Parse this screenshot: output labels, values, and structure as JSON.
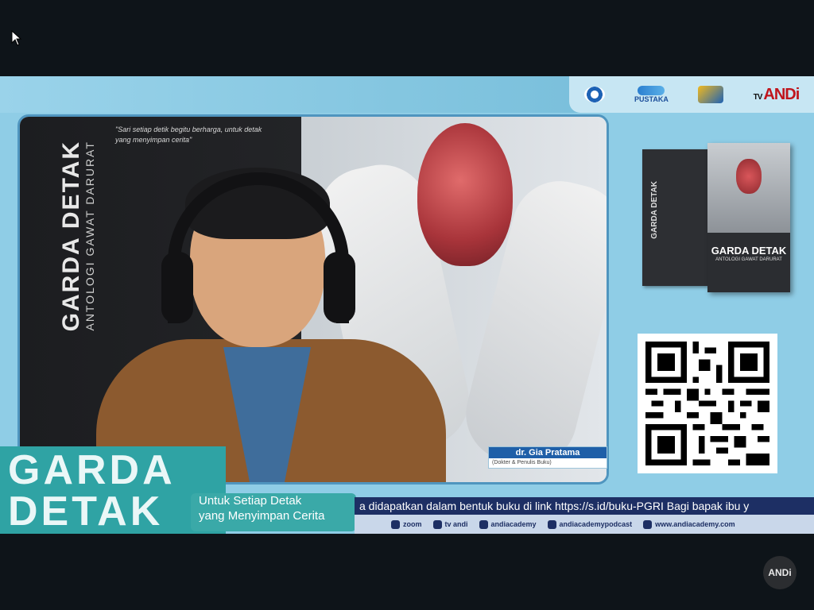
{
  "logos": {
    "logo1_label": "",
    "logo2_label": "PUSTAKA",
    "logo3_label": "",
    "logo4_tv": "TV",
    "logo4_name": "ANDi"
  },
  "video": {
    "book_spine_title": "GARDA DETAK",
    "book_spine_subtitle": "ANTOLOGI GAWAT DARURAT",
    "quote_text": "\"Sari setiap detik begitu berharga, untuk detak yang menyimpan cerita\""
  },
  "speaker": {
    "name": "dr. Gia Pratama",
    "role": "(Dokter & Penulis Buku)"
  },
  "book_cover": {
    "front_title": "GARDA DETAK",
    "front_subtitle": "ANTOLOGI GAWAT DARURAT",
    "back_title": "GARDA DETAK"
  },
  "show": {
    "title_line1": "GARDA",
    "title_line2": "DETAK",
    "tagline_line1": "Untuk Setiap Detak",
    "tagline_line2": "yang Menyimpan Cerita"
  },
  "ticker": {
    "text": "a didapatkan dalam bentuk buku di link https://s.id/buku-PGRI    Bagi bapak ibu y"
  },
  "socials": [
    {
      "icon": "zoom-icon",
      "label": "zoom"
    },
    {
      "icon": "tv-icon",
      "label": "tv andi"
    },
    {
      "icon": "instagram-icon",
      "label": "andiacademy"
    },
    {
      "icon": "podcast-icon",
      "label": "andiacademypodcast"
    },
    {
      "icon": "web-icon",
      "label": "www.andiacademy.com"
    }
  ],
  "watermark": {
    "text": "ANDi"
  },
  "colors": {
    "background": "#0e1419",
    "stage": "#8fcde6",
    "title_block": "#2fa3a4",
    "ticker": "#1d2f64",
    "name_card": "#1f5fa8"
  }
}
